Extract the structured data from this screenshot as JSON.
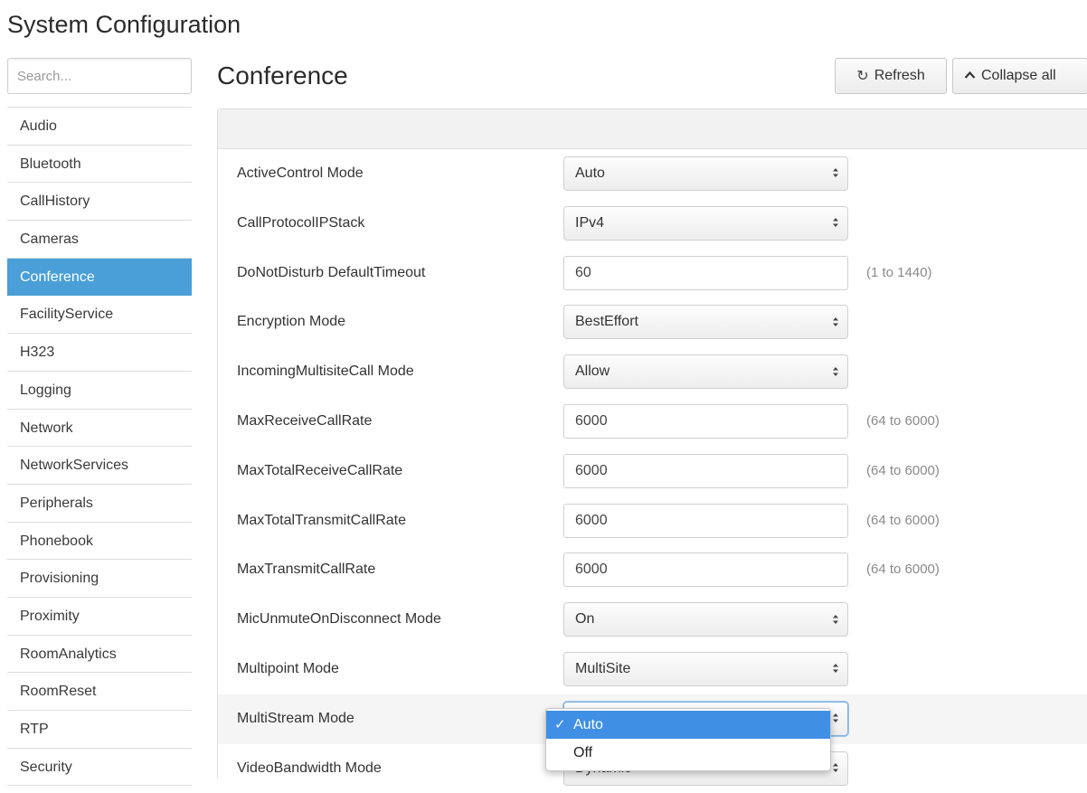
{
  "app": {
    "title": "System Configuration"
  },
  "sidebar": {
    "search_placeholder": "Search...",
    "items": [
      {
        "label": "Audio"
      },
      {
        "label": "Bluetooth"
      },
      {
        "label": "CallHistory"
      },
      {
        "label": "Cameras"
      },
      {
        "label": "Conference",
        "active": true
      },
      {
        "label": "FacilityService"
      },
      {
        "label": "H323"
      },
      {
        "label": "Logging"
      },
      {
        "label": "Network"
      },
      {
        "label": "NetworkServices"
      },
      {
        "label": "Peripherals"
      },
      {
        "label": "Phonebook"
      },
      {
        "label": "Provisioning"
      },
      {
        "label": "Proximity"
      },
      {
        "label": "RoomAnalytics"
      },
      {
        "label": "RoomReset"
      },
      {
        "label": "RTP"
      },
      {
        "label": "Security"
      }
    ]
  },
  "main": {
    "title": "Conference",
    "toolbar": {
      "refresh_label": "Refresh",
      "refresh_icon": "refresh-icon",
      "collapse_label": "Collapse all",
      "collapse_icon": "chevron-up-icon"
    },
    "settings": [
      {
        "label": "ActiveControl Mode",
        "type": "select",
        "value": "Auto"
      },
      {
        "label": "CallProtocolIPStack",
        "type": "select",
        "value": "IPv4"
      },
      {
        "label": "DoNotDisturb DefaultTimeout",
        "type": "input",
        "value": "60",
        "hint": "(1 to 1440)"
      },
      {
        "label": "Encryption Mode",
        "type": "select",
        "value": "BestEffort"
      },
      {
        "label": "IncomingMultisiteCall Mode",
        "type": "select",
        "value": "Allow"
      },
      {
        "label": "MaxReceiveCallRate",
        "type": "input",
        "value": "6000",
        "hint": "(64 to 6000)"
      },
      {
        "label": "MaxTotalReceiveCallRate",
        "type": "input",
        "value": "6000",
        "hint": "(64 to 6000)"
      },
      {
        "label": "MaxTotalTransmitCallRate",
        "type": "input",
        "value": "6000",
        "hint": "(64 to 6000)"
      },
      {
        "label": "MaxTransmitCallRate",
        "type": "input",
        "value": "6000",
        "hint": "(64 to 6000)"
      },
      {
        "label": "MicUnmuteOnDisconnect Mode",
        "type": "select",
        "value": "On"
      },
      {
        "label": "Multipoint Mode",
        "type": "select",
        "value": "MultiSite"
      },
      {
        "label": "MultiStream Mode",
        "type": "select",
        "value": "",
        "open": true
      },
      {
        "label": "VideoBandwidth Mode",
        "type": "select",
        "value": "Dynamic"
      }
    ],
    "dropdown": {
      "options": [
        {
          "label": "Auto",
          "selected": true
        },
        {
          "label": "Off",
          "selected": false
        }
      ],
      "check_glyph": "✓"
    }
  },
  "colors": {
    "accent": "#4a9fd8",
    "dropdown_highlight": "#3f8fe4"
  }
}
